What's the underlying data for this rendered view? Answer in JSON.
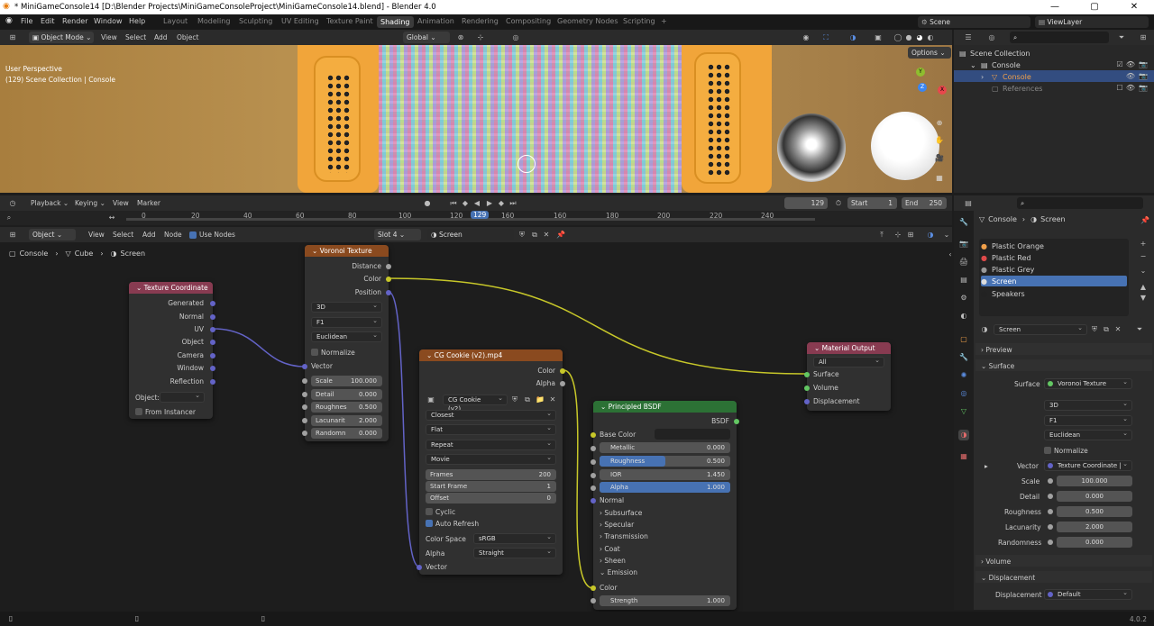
{
  "window": {
    "title": "* MiniGameConsole14 [D:\\Blender Projects\\MiniGameConsoleProject\\MiniGameConsole14.blend] - Blender 4.0",
    "min": "—",
    "max": "▢",
    "close": "✕"
  },
  "menu": [
    "File",
    "Edit",
    "Render",
    "Window",
    "Help"
  ],
  "workspaces": [
    "Layout",
    "Modeling",
    "Sculpting",
    "UV Editing",
    "Texture Paint",
    "Shading",
    "Animation",
    "Rendering",
    "Compositing",
    "Geometry Nodes",
    "Scripting"
  ],
  "workspace_add": "+",
  "scene": "Scene",
  "view_layer": "ViewLayer",
  "viewport_header": {
    "mode": "Object Mode",
    "menus": [
      "View",
      "Select",
      "Add",
      "Object"
    ],
    "orientation": "Global",
    "options": "Options"
  },
  "viewport": {
    "line1": "User Perspective",
    "line2": "(129) Scene Collection | Console"
  },
  "gizmo": {
    "y": "Y",
    "z": "Z",
    "x": "X"
  },
  "outliner": {
    "items": [
      {
        "label": "Scene Collection"
      },
      {
        "label": "Console"
      },
      {
        "label": "Console"
      },
      {
        "label": "References"
      }
    ]
  },
  "timeline": {
    "menus": [
      "Playback",
      "Keying",
      "View",
      "Marker"
    ],
    "frame": "129",
    "start_label": "Start",
    "start": "1",
    "end_label": "End",
    "end": "250",
    "ticks": [
      "0",
      "20",
      "40",
      "60",
      "80",
      "100",
      "120",
      "129",
      "160",
      "160",
      "180",
      "200",
      "220",
      "240"
    ]
  },
  "node_header": {
    "type": "Object",
    "menus": [
      "View",
      "Select",
      "Add",
      "Node"
    ],
    "use_nodes": "Use Nodes",
    "slot": "Slot 4",
    "material": "Screen"
  },
  "breadcrumb": [
    "Console",
    "Cube",
    "Screen"
  ],
  "nodes": {
    "texcoord": {
      "title": "Texture Coordinate",
      "outputs": [
        "Generated",
        "Normal",
        "UV",
        "Object",
        "Camera",
        "Window",
        "Reflection"
      ],
      "object_label": "Object:",
      "from_instancer": "From Instancer"
    },
    "voronoi": {
      "title": "Voronoi Texture",
      "outputs": [
        "Distance",
        "Color",
        "Position"
      ],
      "dims": "3D",
      "feature": "F1",
      "metric": "Euclidean",
      "normalize": "Normalize",
      "vector": "Vector",
      "fields": [
        {
          "label": "Scale",
          "value": "100.000"
        },
        {
          "label": "Detail",
          "value": "0.000"
        },
        {
          "label": "Roughnes",
          "value": "0.500"
        },
        {
          "label": "Lacunarit",
          "value": "2.000"
        },
        {
          "label": "Randomn",
          "value": "0.000"
        }
      ]
    },
    "image": {
      "title": "CG Cookie (v2).mp4",
      "outputs": [
        "Color",
        "Alpha"
      ],
      "image_name": "CG Cookie (v2)....",
      "interp": "Closest",
      "proj": "Flat",
      "ext": "Repeat",
      "source": "Movie",
      "frames_label": "Frames",
      "frames": "200",
      "start_label": "Start Frame",
      "start": "1",
      "offset_label": "Offset",
      "offset": "0",
      "cyclic": "Cyclic",
      "auto_refresh": "Auto Refresh",
      "cs_label": "Color Space",
      "cs": "sRGB",
      "alpha_label": "Alpha",
      "alpha": "Straight",
      "vector": "Vector"
    },
    "bsdf": {
      "title": "Principled BSDF",
      "output": "BSDF",
      "base_color": "Base Color",
      "fields": [
        {
          "label": "Metallic",
          "value": "0.000",
          "fill": 0
        },
        {
          "label": "Roughness",
          "value": "0.500",
          "fill": 0.5
        },
        {
          "label": "IOR",
          "value": "1.450",
          "fill": 0
        },
        {
          "label": "Alpha",
          "value": "1.000",
          "fill": 1
        }
      ],
      "normal": "Normal",
      "panels": [
        "Subsurface",
        "Specular",
        "Transmission",
        "Coat",
        "Sheen",
        "Emission"
      ],
      "color": "Color",
      "strength_label": "Strength",
      "strength": "1.000"
    },
    "output": {
      "title": "Material Output",
      "target": "All",
      "inputs": [
        "Surface",
        "Volume",
        "Displacement"
      ]
    }
  },
  "properties": {
    "object": "Console",
    "material": "Screen",
    "slots": [
      "Plastic Orange",
      "Plastic Red",
      "Plastic Grey",
      "Screen",
      "Speakers"
    ],
    "mat_name": "Screen",
    "preview": "Preview",
    "surface": "Surface",
    "surface_label": "Surface",
    "surface_value": "Voronoi Texture",
    "dims": "3D",
    "feature": "F1",
    "metric": "Euclidean",
    "normalize": "Normalize",
    "vector_label": "Vector",
    "vector_value": "Texture Coordinate | ...",
    "fields": [
      {
        "label": "Scale",
        "value": "100.000"
      },
      {
        "label": "Detail",
        "value": "0.000"
      },
      {
        "label": "Roughness",
        "value": "0.500"
      },
      {
        "label": "Lacunarity",
        "value": "2.000"
      },
      {
        "label": "Randomness",
        "value": "0.000"
      }
    ],
    "volume": "Volume",
    "displacement": "Displacement",
    "disp_label": "Displacement",
    "disp_value": "Default"
  },
  "status": {
    "version": "4.0.2"
  },
  "colors": {
    "accent": "#4772b3",
    "header_texcoord": "#883b51",
    "header_voronoi": "#8a4a1f",
    "header_image": "#8a4a1f",
    "header_bsdf": "#2c7135",
    "header_output": "#883b51"
  }
}
